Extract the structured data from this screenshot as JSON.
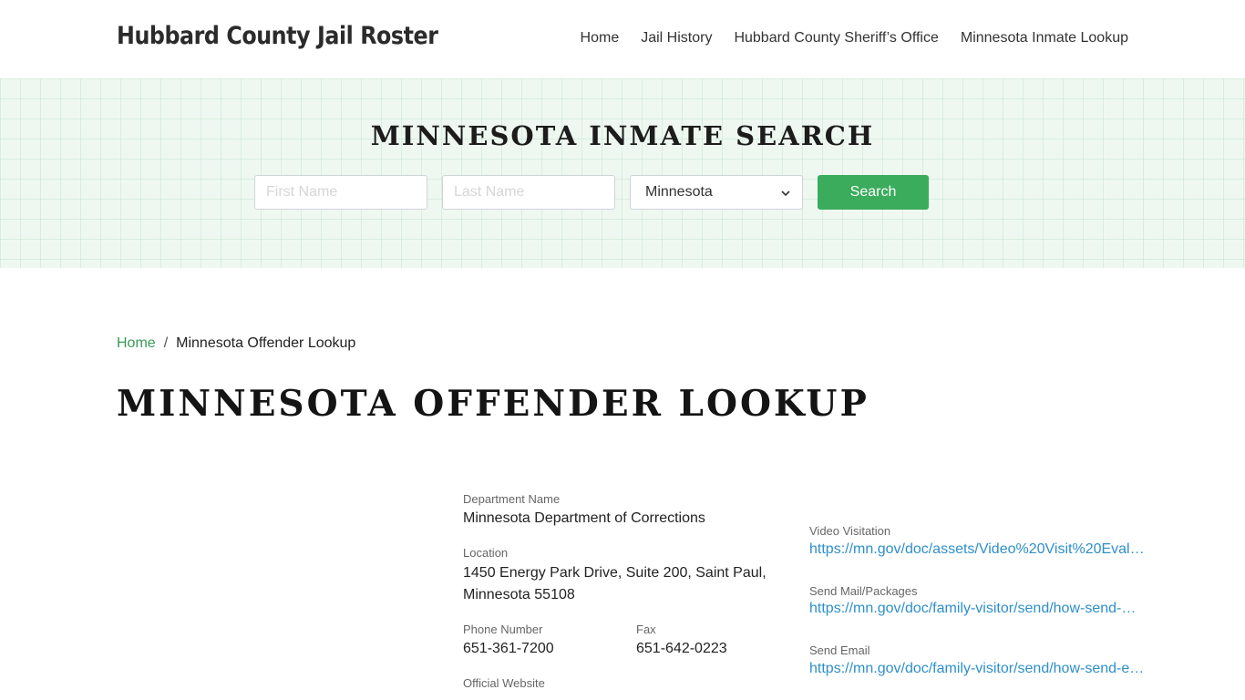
{
  "header": {
    "site_title": "Hubbard County Jail Roster",
    "nav": [
      "Home",
      "Jail History",
      "Hubbard County Sheriff’s Office",
      "Minnesota Inmate Lookup"
    ]
  },
  "search": {
    "title": "MINNESOTA INMATE SEARCH",
    "first_name_placeholder": "First Name",
    "last_name_placeholder": "Last Name",
    "state_selected": "Minnesota",
    "button_label": "Search"
  },
  "breadcrumb": {
    "home": "Home",
    "separator": "/",
    "current": "Minnesota Offender Lookup"
  },
  "page_title": "MINNESOTA OFFENDER LOOKUP",
  "details": {
    "department_label": "Department Name",
    "department_value": "Minnesota Department of Corrections",
    "location_label": "Location",
    "location_line1": "1450 Energy Park Drive, Suite 200, Saint Paul,",
    "location_line2": "Minnesota 55108",
    "phone_label": "Phone Number",
    "phone_value": "651-361-7200",
    "fax_label": "Fax",
    "fax_value": "651-642-0223",
    "website_label": "Official Website",
    "video_label": "Video Visitation",
    "video_value": "https://mn.gov/doc/assets/Video%20Visit%20Evalu…",
    "mail_label": "Send Mail/Packages",
    "mail_value": "https://mn.gov/doc/family-visitor/send/how-send-…",
    "email_label": "Send Email",
    "email_value": "https://mn.gov/doc/family-visitor/send/how-send-e…"
  },
  "colors": {
    "accent_green": "#3bac5c",
    "link_blue": "#2e8fc9",
    "hero_bg": "#eef8f1"
  }
}
